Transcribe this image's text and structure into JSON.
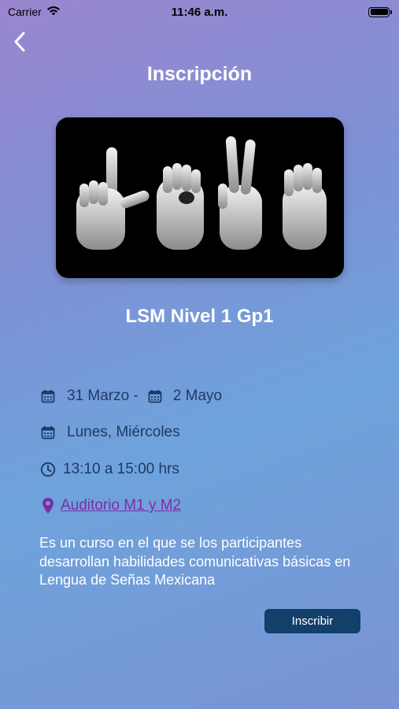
{
  "status_bar": {
    "carrier": "Carrier",
    "time": "11:46 a.m.",
    "wifi_icon": "wifi-icon",
    "battery_icon": "battery-icon",
    "battery_level": 1.0
  },
  "nav": {
    "back_icon": "chevron-left-icon",
    "title": "Inscripción"
  },
  "hero": {
    "image": "hands-spelling-lsm-photo"
  },
  "course": {
    "name": "LSM Nivel 1 Gp1",
    "start_date": "31 Marzo -",
    "end_date": "2 Mayo",
    "days": "Lunes, Miércoles",
    "schedule": "13:10 a 15:00 hrs",
    "location": "Auditorio M1 y M2",
    "description": "Es un curso en el que se los participantes desarrollan habilidades comunicativas básicas en Lengua de Señas Mexicana"
  },
  "actions": {
    "enroll_label": "Inscribir"
  },
  "colors": {
    "accent": "#13406b",
    "info_text": "#1e3a66",
    "link": "#7a2ea6",
    "gradient_start": "#9a86cf",
    "gradient_end": "#6ea3dc"
  }
}
